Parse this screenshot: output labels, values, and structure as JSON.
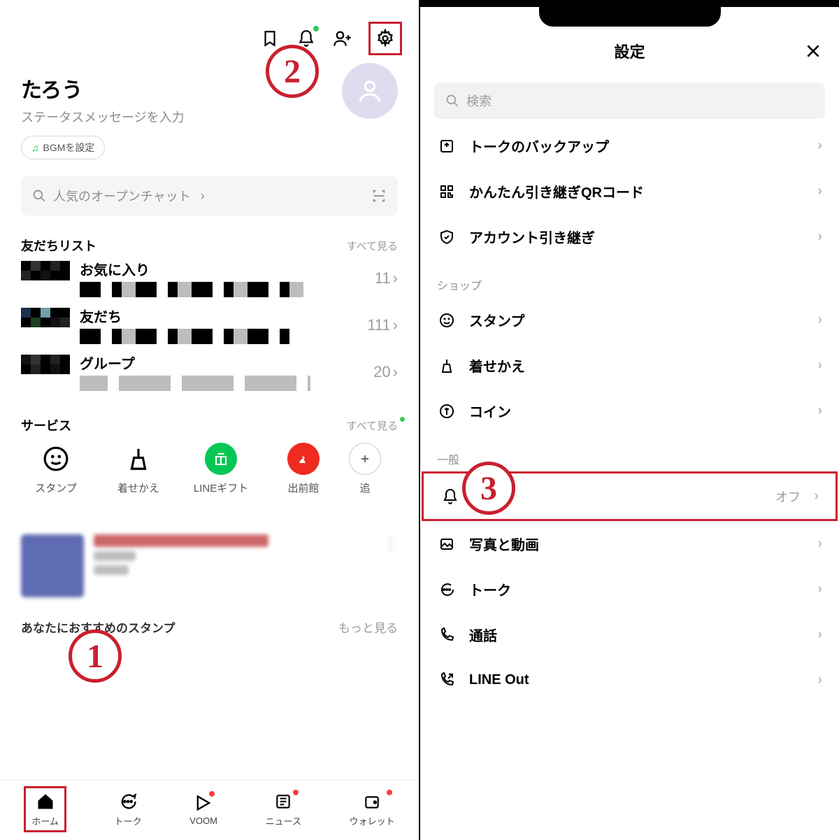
{
  "left": {
    "profile_name": "たろう",
    "profile_status": "ステータスメッセージを入力",
    "bgm_label": "BGMを設定",
    "search_placeholder": "人気のオープンチャット",
    "friends_header": "友だちリスト",
    "see_all": "すべて見る",
    "friend_rows": [
      {
        "name": "お気に入り",
        "count": "11"
      },
      {
        "name": "友だち",
        "count": "111"
      },
      {
        "name": "グループ",
        "count": "20"
      }
    ],
    "services_header": "サービス",
    "services": [
      {
        "label": "スタンプ"
      },
      {
        "label": "着せかえ"
      },
      {
        "label": "LINEギフト"
      },
      {
        "label": "出前館"
      },
      {
        "label": "追"
      }
    ],
    "recs_header": "あなたにおすすめのスタンプ",
    "recs_more": "もっと見る",
    "tabs": [
      {
        "label": "ホーム"
      },
      {
        "label": "トーク"
      },
      {
        "label": "VOOM"
      },
      {
        "label": "ニュース"
      },
      {
        "label": "ウォレット"
      }
    ]
  },
  "right": {
    "title": "設定",
    "search_placeholder": "検索",
    "row_backup": "トークのバックアップ",
    "row_qr": "かんたん引き継ぎQRコード",
    "row_account": "アカウント引き継ぎ",
    "cat_shop": "ショップ",
    "row_stamp": "スタンプ",
    "row_theme": "着せかえ",
    "row_coin": "コイン",
    "cat_general": "一般",
    "row_notif": "通知",
    "row_notif_value": "オフ",
    "row_photo": "写真と動画",
    "row_talk": "トーク",
    "row_call": "通話",
    "row_lineout": "LINE Out"
  },
  "annotations": {
    "a1": "1",
    "a2": "2",
    "a3": "3"
  }
}
